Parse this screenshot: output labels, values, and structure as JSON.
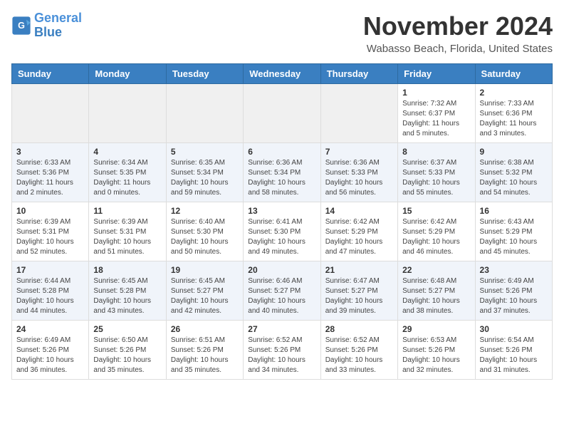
{
  "header": {
    "logo_line1": "General",
    "logo_line2": "Blue",
    "month": "November 2024",
    "location": "Wabasso Beach, Florida, United States"
  },
  "weekdays": [
    "Sunday",
    "Monday",
    "Tuesday",
    "Wednesday",
    "Thursday",
    "Friday",
    "Saturday"
  ],
  "weeks": [
    [
      {
        "day": "",
        "info": ""
      },
      {
        "day": "",
        "info": ""
      },
      {
        "day": "",
        "info": ""
      },
      {
        "day": "",
        "info": ""
      },
      {
        "day": "",
        "info": ""
      },
      {
        "day": "1",
        "info": "Sunrise: 7:32 AM\nSunset: 6:37 PM\nDaylight: 11 hours\nand 5 minutes."
      },
      {
        "day": "2",
        "info": "Sunrise: 7:33 AM\nSunset: 6:36 PM\nDaylight: 11 hours\nand 3 minutes."
      }
    ],
    [
      {
        "day": "3",
        "info": "Sunrise: 6:33 AM\nSunset: 5:36 PM\nDaylight: 11 hours\nand 2 minutes."
      },
      {
        "day": "4",
        "info": "Sunrise: 6:34 AM\nSunset: 5:35 PM\nDaylight: 11 hours\nand 0 minutes."
      },
      {
        "day": "5",
        "info": "Sunrise: 6:35 AM\nSunset: 5:34 PM\nDaylight: 10 hours\nand 59 minutes."
      },
      {
        "day": "6",
        "info": "Sunrise: 6:36 AM\nSunset: 5:34 PM\nDaylight: 10 hours\nand 58 minutes."
      },
      {
        "day": "7",
        "info": "Sunrise: 6:36 AM\nSunset: 5:33 PM\nDaylight: 10 hours\nand 56 minutes."
      },
      {
        "day": "8",
        "info": "Sunrise: 6:37 AM\nSunset: 5:33 PM\nDaylight: 10 hours\nand 55 minutes."
      },
      {
        "day": "9",
        "info": "Sunrise: 6:38 AM\nSunset: 5:32 PM\nDaylight: 10 hours\nand 54 minutes."
      }
    ],
    [
      {
        "day": "10",
        "info": "Sunrise: 6:39 AM\nSunset: 5:31 PM\nDaylight: 10 hours\nand 52 minutes."
      },
      {
        "day": "11",
        "info": "Sunrise: 6:39 AM\nSunset: 5:31 PM\nDaylight: 10 hours\nand 51 minutes."
      },
      {
        "day": "12",
        "info": "Sunrise: 6:40 AM\nSunset: 5:30 PM\nDaylight: 10 hours\nand 50 minutes."
      },
      {
        "day": "13",
        "info": "Sunrise: 6:41 AM\nSunset: 5:30 PM\nDaylight: 10 hours\nand 49 minutes."
      },
      {
        "day": "14",
        "info": "Sunrise: 6:42 AM\nSunset: 5:29 PM\nDaylight: 10 hours\nand 47 minutes."
      },
      {
        "day": "15",
        "info": "Sunrise: 6:42 AM\nSunset: 5:29 PM\nDaylight: 10 hours\nand 46 minutes."
      },
      {
        "day": "16",
        "info": "Sunrise: 6:43 AM\nSunset: 5:29 PM\nDaylight: 10 hours\nand 45 minutes."
      }
    ],
    [
      {
        "day": "17",
        "info": "Sunrise: 6:44 AM\nSunset: 5:28 PM\nDaylight: 10 hours\nand 44 minutes."
      },
      {
        "day": "18",
        "info": "Sunrise: 6:45 AM\nSunset: 5:28 PM\nDaylight: 10 hours\nand 43 minutes."
      },
      {
        "day": "19",
        "info": "Sunrise: 6:45 AM\nSunset: 5:27 PM\nDaylight: 10 hours\nand 42 minutes."
      },
      {
        "day": "20",
        "info": "Sunrise: 6:46 AM\nSunset: 5:27 PM\nDaylight: 10 hours\nand 40 minutes."
      },
      {
        "day": "21",
        "info": "Sunrise: 6:47 AM\nSunset: 5:27 PM\nDaylight: 10 hours\nand 39 minutes."
      },
      {
        "day": "22",
        "info": "Sunrise: 6:48 AM\nSunset: 5:27 PM\nDaylight: 10 hours\nand 38 minutes."
      },
      {
        "day": "23",
        "info": "Sunrise: 6:49 AM\nSunset: 5:26 PM\nDaylight: 10 hours\nand 37 minutes."
      }
    ],
    [
      {
        "day": "24",
        "info": "Sunrise: 6:49 AM\nSunset: 5:26 PM\nDaylight: 10 hours\nand 36 minutes."
      },
      {
        "day": "25",
        "info": "Sunrise: 6:50 AM\nSunset: 5:26 PM\nDaylight: 10 hours\nand 35 minutes."
      },
      {
        "day": "26",
        "info": "Sunrise: 6:51 AM\nSunset: 5:26 PM\nDaylight: 10 hours\nand 35 minutes."
      },
      {
        "day": "27",
        "info": "Sunrise: 6:52 AM\nSunset: 5:26 PM\nDaylight: 10 hours\nand 34 minutes."
      },
      {
        "day": "28",
        "info": "Sunrise: 6:52 AM\nSunset: 5:26 PM\nDaylight: 10 hours\nand 33 minutes."
      },
      {
        "day": "29",
        "info": "Sunrise: 6:53 AM\nSunset: 5:26 PM\nDaylight: 10 hours\nand 32 minutes."
      },
      {
        "day": "30",
        "info": "Sunrise: 6:54 AM\nSunset: 5:26 PM\nDaylight: 10 hours\nand 31 minutes."
      }
    ]
  ]
}
